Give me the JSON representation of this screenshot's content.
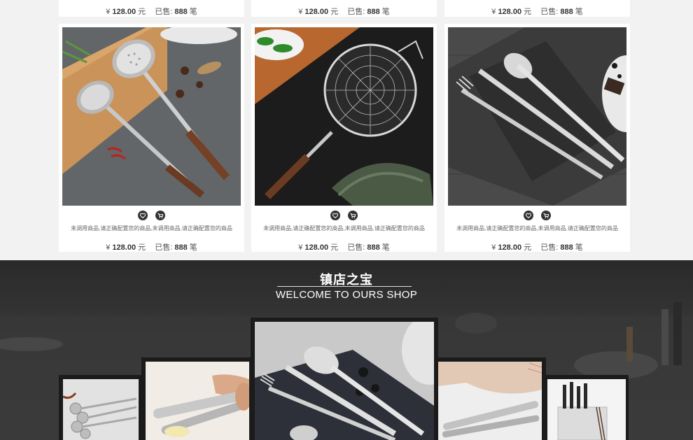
{
  "products": [
    {
      "currency": "¥",
      "price": "128.00",
      "unit": "元",
      "sold_label": "已售:",
      "sold": "888",
      "sold_unit": "笔",
      "desc": "未调用商品,请正确配置您的商品,未调用商品,请正确配置您的商品"
    },
    {
      "currency": "¥",
      "price": "128.00",
      "unit": "元",
      "sold_label": "已售:",
      "sold": "888",
      "sold_unit": "笔",
      "desc": "未调用商品,请正确配置您的商品,未调用商品,请正确配置您的商品"
    },
    {
      "currency": "¥",
      "price": "128.00",
      "unit": "元",
      "sold_label": "已售:",
      "sold": "888",
      "sold_unit": "笔",
      "desc": "未调用商品,请正确配置您的商品,未调用商品,请正确配置您的商品"
    }
  ],
  "top_row": [
    {
      "currency": "¥",
      "price": "128.00",
      "unit": "元",
      "sold_label": "已售:",
      "sold": "888",
      "sold_unit": "笔"
    },
    {
      "currency": "¥",
      "price": "128.00",
      "unit": "元",
      "sold_label": "已售:",
      "sold": "888",
      "sold_unit": "笔"
    },
    {
      "currency": "¥",
      "price": "128.00",
      "unit": "元",
      "sold_label": "已售:",
      "sold": "888",
      "sold_unit": "笔"
    }
  ],
  "section": {
    "title": "镇店之宝",
    "subtitle": "WELCOME TO OURS SHOP"
  },
  "icons": {
    "favorite": "heart-icon",
    "cart": "cart-icon"
  }
}
